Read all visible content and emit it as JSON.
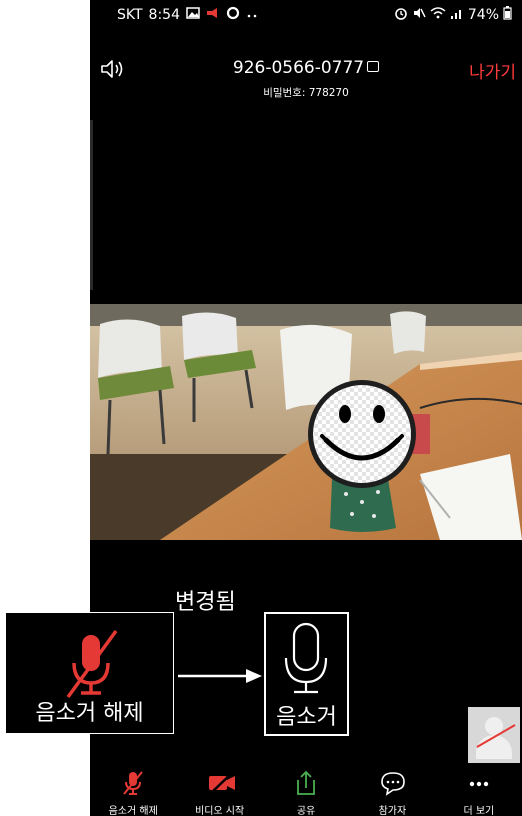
{
  "status_bar": {
    "carrier": "SKT",
    "time": "8:54",
    "battery": "74%",
    "left_icons": [
      "gallery-icon",
      "alert-icon",
      "circle-app-icon",
      "more-dots-icon"
    ],
    "right_icons": [
      "alarm-icon",
      "mute-icon",
      "wifi-icon",
      "signal-icon",
      "battery-icon"
    ]
  },
  "header": {
    "meeting_id": "926-0566-0777",
    "password_label": "비밀번호: 778270",
    "leave_label": "나가기"
  },
  "toolbar": {
    "items": [
      {
        "label": "음소거 해제",
        "icon": "mic-muted-icon"
      },
      {
        "label": "비디오 시작",
        "icon": "video-off-icon"
      },
      {
        "label": "공유",
        "icon": "share-icon"
      },
      {
        "label": "참가자",
        "icon": "participants-icon"
      },
      {
        "label": "더 보기",
        "icon": "more-icon"
      }
    ]
  },
  "annotation": {
    "changed_label": "변경됨",
    "before_label": "음소거 해제",
    "after_label": "음소거"
  },
  "colors": {
    "accent_red": "#ff3b3b",
    "share_green": "#4caf50",
    "background": "#000000"
  }
}
